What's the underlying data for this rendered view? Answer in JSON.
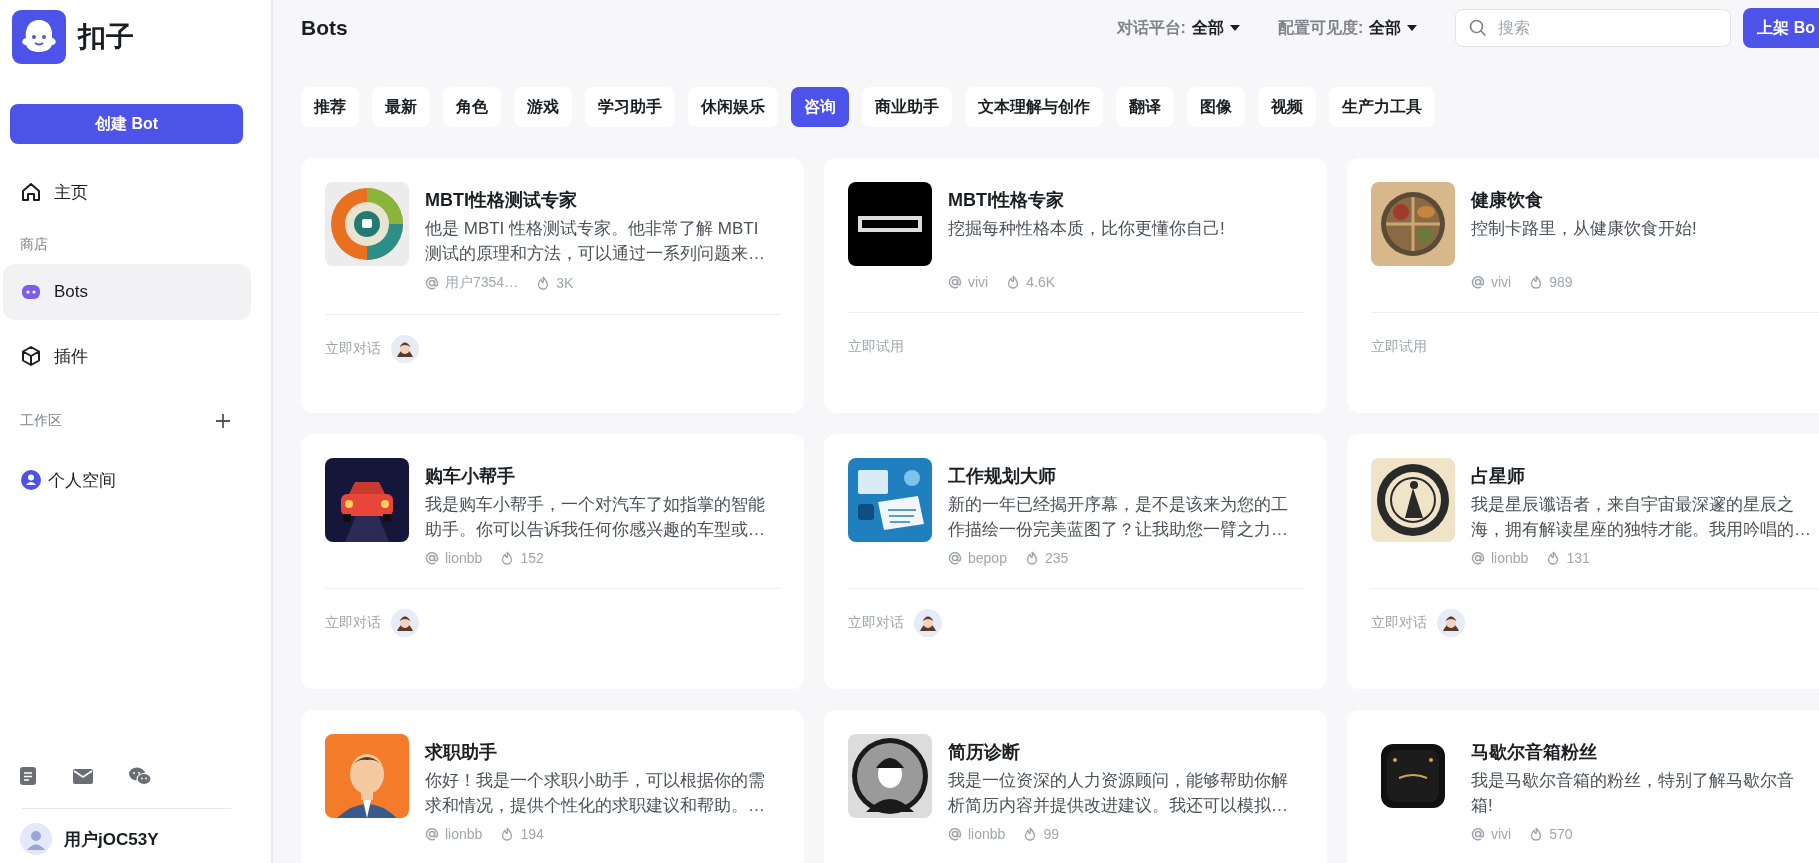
{
  "sidebar": {
    "logo_text": "扣子",
    "create_button": "创建 Bot",
    "nav": [
      {
        "label": "主页",
        "kind": "home",
        "selected": false
      }
    ],
    "store_title": "商店",
    "store_items": [
      {
        "label": "Bots",
        "kind": "bot",
        "selected": true
      },
      {
        "label": "插件",
        "kind": "cube",
        "selected": false
      }
    ],
    "workspace_title": "工作区",
    "workspace_items": [
      {
        "label": "个人空间",
        "kind": "person",
        "selected": false
      }
    ],
    "user_name": "用户jOC53Y"
  },
  "header": {
    "title": "Bots",
    "filters": [
      {
        "label": "对话平台:",
        "value": "全部"
      },
      {
        "label": "配置可见度:",
        "value": "全部"
      }
    ],
    "search": {
      "placeholder": "搜索"
    },
    "publish_button": "上架 Bo"
  },
  "categories": [
    {
      "label": "推荐",
      "selected": false
    },
    {
      "label": "最新",
      "selected": false
    },
    {
      "label": "角色",
      "selected": false
    },
    {
      "label": "游戏",
      "selected": false
    },
    {
      "label": "学习助手",
      "selected": false
    },
    {
      "label": "休闲娱乐",
      "selected": false
    },
    {
      "label": "咨询",
      "selected": true
    },
    {
      "label": "商业助手",
      "selected": false
    },
    {
      "label": "文本理解与创作",
      "selected": false
    },
    {
      "label": "翻译",
      "selected": false
    },
    {
      "label": "图像",
      "selected": false
    },
    {
      "label": "视频",
      "selected": false
    },
    {
      "label": "生产力工具",
      "selected": false
    }
  ],
  "cards": [
    {
      "title": "MBTI性格测试专家",
      "description": "他是 MBTI 性格测试专家。他非常了解 MBTI 测试的原理和方法，可以通过一系列问题来…",
      "author": "用户7354…",
      "count": "3K",
      "action": "立即对话",
      "has_avatar": true
    },
    {
      "title": "MBTI性格专家",
      "description": "挖掘每种性格本质，比你更懂你自己!",
      "author": "vivi",
      "count": "4.6K",
      "action": "立即试用",
      "has_avatar": false
    },
    {
      "title": "健康饮食",
      "description": "控制卡路里，从健康饮食开始!",
      "author": "vivi",
      "count": "989",
      "action": "立即试用",
      "has_avatar": false
    },
    {
      "title": "购车小帮手",
      "description": "我是购车小帮手，一个对汽车了如指掌的智能助手。你可以告诉我任何你感兴趣的车型或…",
      "author": "lionbb",
      "count": "152",
      "action": "立即对话",
      "has_avatar": true
    },
    {
      "title": "工作规划大师",
      "description": "新的一年已经揭开序幕，是不是该来为您的工作描绘一份完美蓝图了？让我助您一臂之力…",
      "author": "bepop",
      "count": "235",
      "action": "立即对话",
      "has_avatar": true
    },
    {
      "title": "占星师",
      "description": "我是星辰谶语者，来自宇宙最深邃的星辰之海，拥有解读星座的独特才能。我用吟唱的…",
      "author": "lionbb",
      "count": "131",
      "action": "立即对话",
      "has_avatar": true
    },
    {
      "title": "求职助手",
      "description": "你好！我是一个求职小助手，可以根据你的需求和情况，提供个性化的求职建议和帮助。…",
      "author": "lionbb",
      "count": "194"
    },
    {
      "title": "简历诊断",
      "description": "我是一位资深的人力资源顾问，能够帮助你解析简历内容并提供改进建议。我还可以模拟…",
      "author": "lionbb",
      "count": "99"
    },
    {
      "title": "马歇尔音箱粉丝",
      "description": "我是马歇尔音箱的粉丝，特别了解马歇尔音箱!",
      "author": "vivi",
      "count": "570"
    }
  ]
}
